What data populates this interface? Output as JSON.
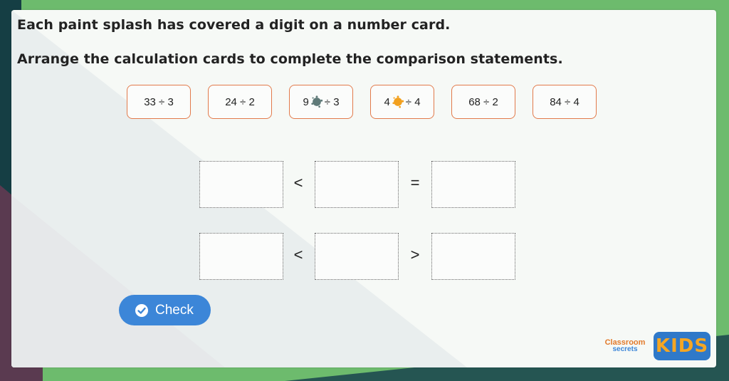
{
  "colors": {
    "outer_green": "#6dbb6d",
    "panel": "#f6f9f6",
    "card_border": "#e27a4b",
    "check_button": "#3c86d8",
    "splash_grey": "#5f7a78",
    "splash_orange": "#f2a01e"
  },
  "instructions": {
    "line1": "Each paint splash has covered a digit on a number card.",
    "line2": "Arrange the calculation cards to complete the comparison statements."
  },
  "cards": [
    {
      "before": "33 ÷ 3",
      "splash": null,
      "after": ""
    },
    {
      "before": "24 ÷ 2",
      "splash": null,
      "after": ""
    },
    {
      "before": "9",
      "splash": "grey-paint-splash-icon",
      "after": "÷ 3"
    },
    {
      "before": "4",
      "splash": "orange-paint-splash-icon",
      "after": "÷ 4"
    },
    {
      "before": "68 ÷ 2",
      "splash": null,
      "after": ""
    },
    {
      "before": "84 ÷ 4",
      "splash": null,
      "after": ""
    }
  ],
  "statements": [
    {
      "symbols": [
        "<",
        "="
      ]
    },
    {
      "symbols": [
        "<",
        ">"
      ]
    }
  ],
  "check_button": {
    "label": "Check",
    "icon": "check-circle-icon"
  },
  "branding": {
    "line1": "Classroom",
    "line2": "secrets",
    "kids": "KIDS"
  }
}
